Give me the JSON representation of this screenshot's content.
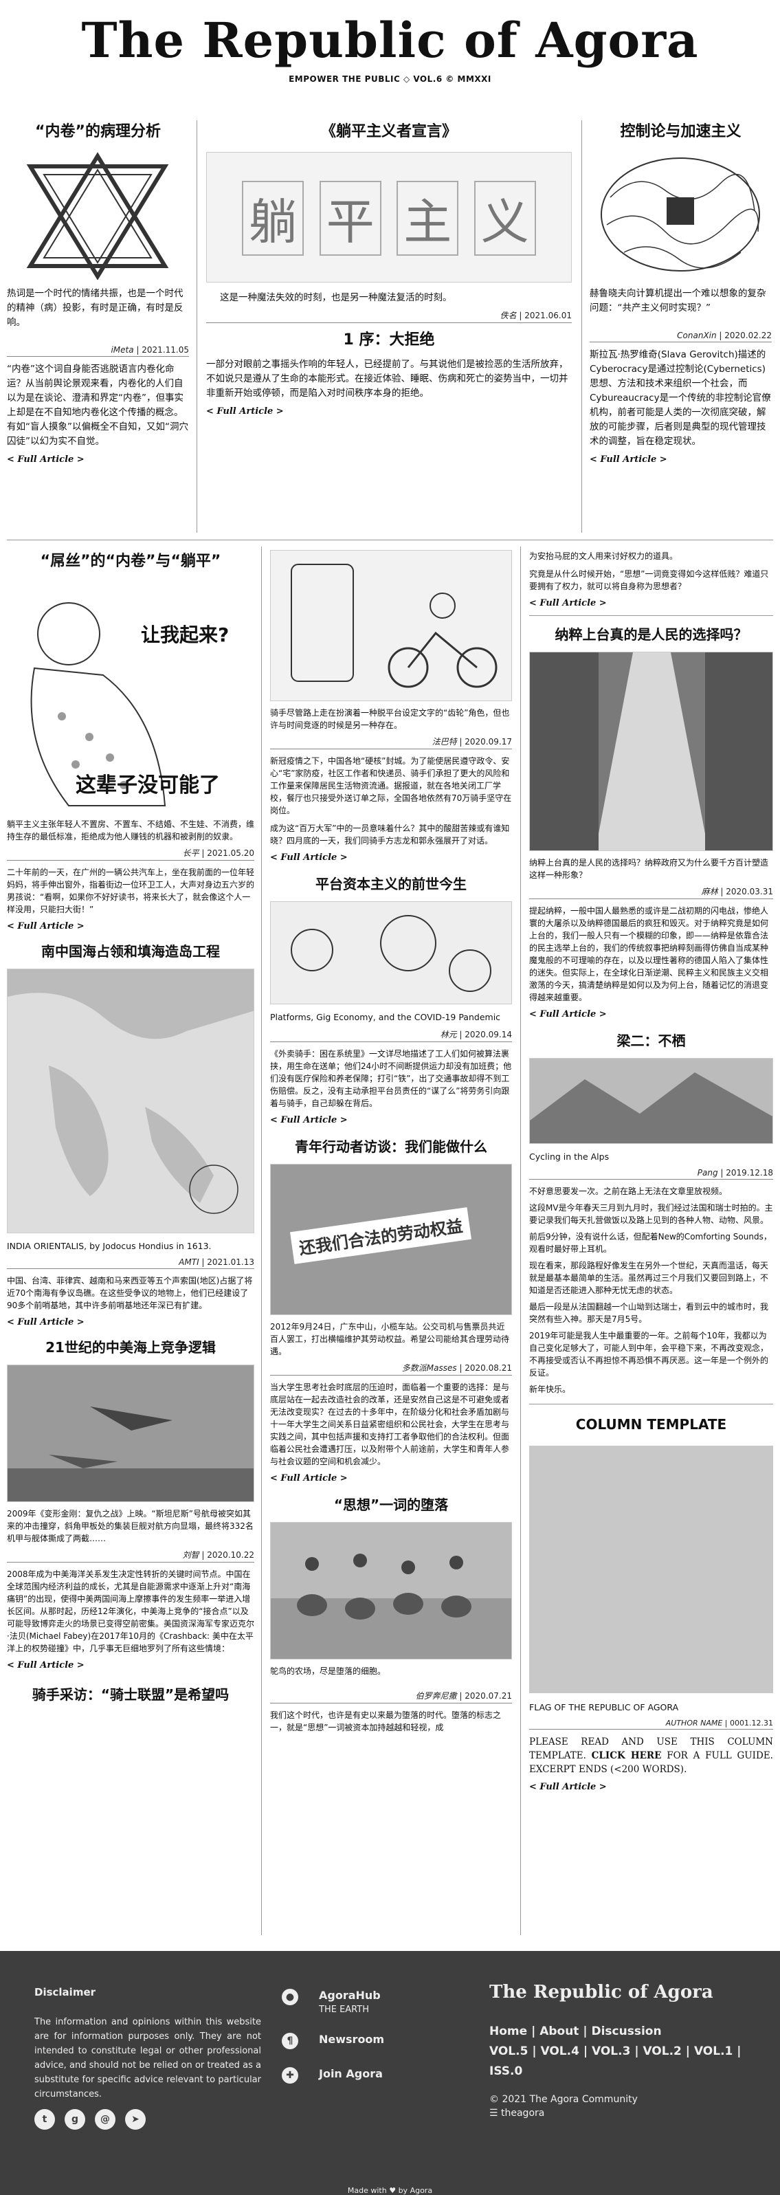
{
  "masthead": {
    "title": "The Republic of Agora",
    "sub": "EMPOWER THE PUBLIC ◇ VOL.6 © MMXXI"
  },
  "top": {
    "left": {
      "title": "“内卷”的病理分析",
      "lead": "热词是一个时代的情绪共振，也是一个时代的精神（病）投影，有时是正确，有时是反响。",
      "author": "iMeta",
      "date": "2021.11.05",
      "body": "“内卷”这个词自身能否逃脱语言内卷化命运？从当前舆论景观来看，内卷化的人们自以为是在谈论、澄清和界定“内卷”，但事实上却是在不自知地内卷化这个传播的概念。有如“盲人摸象”以偏概全不自知，又如“洞穴囚徒”以幻为实不自觉。",
      "more": "< Full Article >"
    },
    "center": {
      "title": "《躺平主义者宣言》",
      "banner": "躺平主义",
      "lead": "这是一种魔法失效的时刻，也是另一种魔法复活的时刻。",
      "author": "佚名",
      "date": "2021.06.01",
      "subtitle": "1 序：大拒绝",
      "body": "一部分对眼前之事摇头作响的年轻人，已经提前了。与其说他们是被捡恶的生活所放弃，不如说只是遵从了生命的本能形式。在接近体验、睡眠、伤病和死亡的姿势当中，一切并非重新开始或停顿，而是陷入对时间秩序本身的拒绝。",
      "more": "< Full Article >"
    },
    "right": {
      "title": "控制论与加速主义",
      "lead": "赫鲁晓夫向计算机提出一个难以想象的复杂问题：“共产主义何时实现？”",
      "author": "ConanXin",
      "date": "2020.02.22",
      "body": "斯拉瓦·热罗维奇(Slava Gerovitch)描述的Cyberocracy是通过控制论(Cybernetics)思想、方法和技术来组织一个社会，而Cybureaucracy是一个传统的非控制论官僚机构，前者可能是人类的一次彻底突破，解放的可能步骤，后者则是典型的现代管理技术的调整，旨在稳定现状。",
      "more": "< Full Article >"
    }
  },
  "col1": {
    "a1": {
      "title": "“屌丝”的“内卷”与“躺平”",
      "img_text1": "让我起来?",
      "img_text2": "这辈子没可能了",
      "lead": "躺平主义主张年轻人不置房、不置车、不结婚、不生娃、不消费，维持生存的最低标准，拒绝成为他人赚钱的机器和被剥削的奴隶。",
      "author": "长平",
      "date": "2021.05.20",
      "body": "二十年前的一天，在广州的一辆公共汽车上，坐在我前面的一位年轻妈妈，将手伸出窗外，指着街边一位环卫工人，大声对身边五六岁的男孩说：“看啊，如果你不好好读书，将来长大了，就会像这个人一样没用，只能扫大街！”",
      "more": "< Full Article >"
    },
    "a2": {
      "title": "南中国海占领和填海造岛工程",
      "caption": "INDIA ORIENTALIS, by Jodocus Hondius in 1613.",
      "author": "AMTI",
      "date": "2021.01.13",
      "body": "中国、台湾、菲律宾、越南和马来西亚等五个声索国(地区)占据了将近70个南海有争议岛礁。在这些受争议的地物上，他们已经建设了90多个前哨基地，其中许多前哨基地还年深已有扩建。",
      "more": "< Full Article >"
    },
    "a3": {
      "title": "21世纪的中美海上竞争逻辑",
      "lead": "2009年《变形金刚：复仇之战》上映。“斯坦尼斯”号航母被突如其来的冲击撞穿，斜角甲板处的集装巨舰对航方向显塌，最终将332名机甲与舰体撕成了两截……",
      "author": "刘智",
      "date": "2020.10.22",
      "body": "2008年成为中美海洋关系发生决定性转折的关键时间节点。中国在全球范围内经济利益的成长，尤其是自能源需求中逐渐上升对“南海痛钥”的出现，使得中美两国间海上摩擦事件的发生频率一举进入增长区间。从那时起，历经12年演化，中美海上竞争的“接合点”以及可能导致博弈走火的场景已变得空前密集。美国资深海军专家迈克尔·法贝(Michael Fabey)在2017年10月的《Crashback: 美中在太平洋上的权势碰撞》中，几乎事无巨细地罗列了所有这些情境：",
      "more": "< Full Article >"
    },
    "a4": {
      "title": "骑手采访：“骑士联盟”是希望吗"
    }
  },
  "col2": {
    "a1": {
      "lead": "骑手尽管路上走在扮演着一种脱平台设定文字的“齿轮”角色，但也许与时间竞逐的时候是另一种存在。",
      "author": "法巴特",
      "date": "2020.09.17",
      "body": "新冠疫情之下，中国各地“硬核”封城。为了能使居民遵守政令、安心“宅”家防疫，社区工作者和快递员、骑手们承担了更大的风险和工作量来保障居民生活物资流通。据报道，就在各地关闭工厂学校，餐厅也只接受外送订单之际，全国各地依然有70万骑手坚守在岗位。",
      "body2": "成为这“百万大军”中的一员意味着什么？其中的酸甜苦辣或有谁知晓？四月底的一天，我们同骑手方志龙和郭永强展开了对话。",
      "more": "< Full Article >"
    },
    "a2": {
      "title": "平台资本主义的前世今生",
      "caption": "Platforms, Gig Economy, and the COVID-19 Pandemic",
      "author": "林元",
      "date": "2020.09.14",
      "body": "《外卖骑手：困在系统里》一文详尽地描述了工人们如何被算法裹挟，用生命在送单；他们24小时不间断提供运力却没有加班费；他们没有医疗保险和养老保障；打引“铁”，出了交通事故却得不到工伤赔偿。反之，没有主动承担平台员责任的“谋了么”将劳务引向跟着与骑手，自己却躲在背后。",
      "more": "< Full Article >"
    },
    "a3": {
      "title": "青年行动者访谈：我们能做什么",
      "banner": "还我们合法的劳动权益",
      "lead": "2012年9月24日，广东中山，小榄车站。公交司机与售票员共近百人罢工，打出横幅维护其劳动权益。希望公司能给其合理劳动待遇。",
      "author": "多数派Masses",
      "date": "2020.08.21",
      "body": "当大学生思考社会时底层的压迫时，面临着一个重要的选择：是与底层站在一起去改造社会的改革，还是安然自己这是不可避免或者无法改变现实？在过去的十多年中，在阶级分化和社会矛盾加剧与十一年大学生之间关系日益紧密组织和公民社会，大学生在思考与实践之间，其中包括声援和支持打工者争取他们的合法权利。但面临着公民社会遭遇打压，以及附带个人前途前，大学生和青年人参与社会议题的空间和机会减少。",
      "more": "< Full Article >"
    },
    "a4": {
      "title": "“思想”一词的堕落",
      "lead": "鸵鸟的农场，尽是堕落的细胞。",
      "author": "伯罗奔尼撒",
      "date": "2020.07.21",
      "body": "我们这个时代，也许是有史以来最为堕落的时代。堕落的标志之一，就是“思想”一词被资本加持越越和轻视，成"
    }
  },
  "col3": {
    "top": {
      "body": "为安抬马屁的文人用来讨好权力的道具。",
      "body2": "究竟是从什么时候开始，“思想”一词竟变得如今这样低贱？难道只要拥有了权力，就可以将自身称为思想者？",
      "more": "< Full Article >"
    },
    "a1": {
      "title": "纳粹上台真的是人民的选择吗？",
      "lead": "纳粹上台真的是人民的选择吗？纳粹政府又为什么要千方百计塑造这样一种形象？",
      "author": "麻林",
      "date": "2020.03.31",
      "body": "提起纳粹，一般中国人最熟悉的或许是二战初期的闪电战，惨绝人寰的大屠杀以及纳粹德国最后的疯狂和毁灭。对于纳粹究竟是如何上台的，我们一般人只有一个模糊的印象，即——纳粹是依靠合法的民主选举上台的，我们的传统叙事把纳粹刻画得仿佛自当成某种魔鬼般的不可理喻的存在，以及以理性著称的德国人陷入了集体性的迷失。但实际上，在全球化日渐逆潮、民粹主义和民族主义交相激荡的今天，搞清楚纳粹是如何以及为何上台，随着记忆的消退变得越来越重要。",
      "more": "< Full Article >"
    },
    "a2": {
      "title": "梁二：不栖",
      "caption": "Cycling in the Alps",
      "author": "Pang",
      "date": "2019.12.18",
      "body": "不好意思要发一次。之前在路上无法在文章里放视频。",
      "body2": "这段MV是今年春天三月到九月时，我们经过法国和瑞士时拍的。主要记录我们每天扎营做饭以及路上见到的各种人物、动物、风景。",
      "body3": "前后9分钟，没有说什么话，但配着New的Comforting Sounds，观看时最好带上耳机。",
      "body4": "现在看来，那段路程好像发生在另外一个世纪，天真而温话，每天就是最基本最简单的生活。虽然再过三个月我们又要回到路上，不知道是否还能进入那种无忧无虑的状态。",
      "body5": "最后一段是从法国翻越一个山坳到达瑞士，看到云中的城市时，我突然有些入神。那天是7月5号。",
      "body6": "2019年可能是我人生中最重要的一年。之前每个10年，我都以为自己变化足够大了，可能人到中年，会平稳下来，不再改变观念，不再接受或否认不再担惊不再恐惧不再厌恶。这一年是一个例外的反证。",
      "body7": "新年快乐。"
    },
    "a3": {
      "title": "COLUMN TEMPLATE",
      "caption": "FLAG OF THE REPUBLIC OF AGORA",
      "author": "AUTHOR NAME",
      "date": "0001.12.31",
      "body": "PLEASE READ AND USE THIS COLUMN TEMPLATE.",
      "click": "CLICK HERE",
      "body_tail": "FOR A FULL GUIDE. EXCERPT ENDS (<200 WORDS).",
      "more": "< Full Article >"
    }
  },
  "footer": {
    "disclaimer_title": "Disclaimer",
    "disclaimer": "The information and opinions within this website are for information purposes only. They are not intended to constitute legal or other professional advice, and should not be relied on or treated as a substitute for specific advice relevant to particular circumstances.",
    "hub": "AgoraHub",
    "hub_sub": "THE EARTH",
    "newsroom": "Newsroom",
    "join": "Join Agora",
    "logo": "The Republic of Agora",
    "links1": [
      "Home",
      "About",
      "Discussion"
    ],
    "links2": [
      "VOL.5",
      "VOL.4",
      "VOL.3",
      "VOL.2",
      "VOL.1"
    ],
    "links3": [
      "ISS.0"
    ],
    "copy": "© 2021 The Agora Community",
    "handle": "☰ theagora",
    "made": "Made with ♥ by Agora",
    "social_icons": [
      "twitter-icon",
      "github-icon",
      "email-icon",
      "telegram-icon"
    ]
  }
}
